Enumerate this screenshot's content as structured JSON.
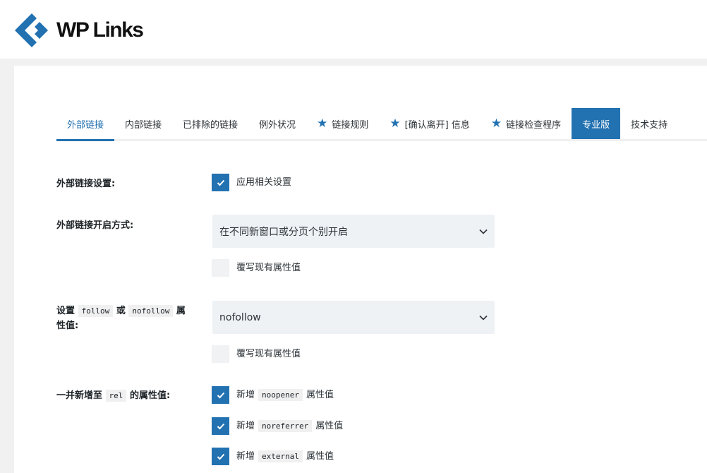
{
  "brand": {
    "name": "WP Links",
    "accent": "#2271b1",
    "logo_icon": "diamond-chevron-logo"
  },
  "tabs": [
    {
      "label": "外部链接",
      "active": true,
      "starred": false
    },
    {
      "label": "内部链接",
      "active": false,
      "starred": false
    },
    {
      "label": "已排除的链接",
      "active": false,
      "starred": false
    },
    {
      "label": "例外状况",
      "active": false,
      "starred": false
    },
    {
      "label": "链接规则",
      "active": false,
      "starred": true
    },
    {
      "label": "[确认离开] 信息",
      "active": false,
      "starred": true
    },
    {
      "label": "链接检查程序",
      "active": false,
      "starred": true
    },
    {
      "label": "专业版",
      "active": false,
      "starred": false,
      "highlighted": true
    },
    {
      "label": "技术支持",
      "active": false,
      "starred": false
    }
  ],
  "settings": {
    "external_links": {
      "label": "外部链接设置:",
      "checkbox_label": "应用相关设置",
      "checked": true
    },
    "open_method": {
      "label": "外部链接开启方式:",
      "selected": "在不同新窗口或分页个别开启",
      "overwrite_label": "覆写现有属性值",
      "overwrite_checked": false
    },
    "follow": {
      "label_prefix": "设置",
      "code1": "follow",
      "label_mid": "或",
      "code2": "nofollow",
      "label_suffix": "属",
      "label_line2": "性值:",
      "selected": "nofollow",
      "overwrite_label": "覆写现有属性值",
      "overwrite_checked": false
    },
    "rel": {
      "label_prefix": "一并新增至",
      "code": "rel",
      "label_suffix": "的属性值:",
      "options": [
        {
          "prefix": "新增",
          "code": "noopener",
          "suffix": "属性值",
          "checked": true
        },
        {
          "prefix": "新增",
          "code": "noreferrer",
          "suffix": "属性值",
          "checked": true
        },
        {
          "prefix": "新增",
          "code": "external",
          "suffix": "属性值",
          "checked": true
        }
      ]
    }
  }
}
